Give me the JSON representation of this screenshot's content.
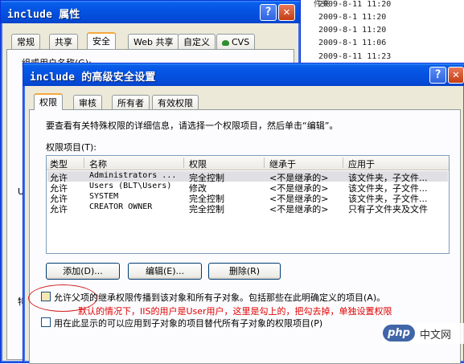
{
  "background_list": {
    "fragment_top": "件夹",
    "rows": [
      "2009-8-11 11:20",
      "2009-8-1 11:20",
      "2009-8-1 11:20",
      "2009-8-1 11:06",
      "2009-8-11 11:23"
    ]
  },
  "back_window": {
    "title": "include 属性",
    "help_btn": "?",
    "close_btn": "✕",
    "tabs": [
      "常规",
      "共享",
      "安全",
      "Web 共享",
      "自定义",
      "CVS"
    ],
    "active_tab": "安全",
    "group_label": "组或用户名称(G):",
    "side_letters": [
      "U",
      "特"
    ]
  },
  "front_window": {
    "title": "include 的高级安全设置",
    "help_btn": "?",
    "close_btn": "✕",
    "tabs": [
      "权限",
      "审核",
      "所有者",
      "有效权限"
    ],
    "active_tab": "权限",
    "instruction": "要查看有关特殊权限的详细信息，请选择一个权限项目，然后单击“编辑”。",
    "entries_label": "权限项目(T):",
    "columns": [
      "类型",
      "名称",
      "权限",
      "继承于",
      "应用于"
    ],
    "rows": [
      {
        "type": "允许",
        "name": "Administrators ...",
        "perm": "完全控制",
        "inherited": "<不是继承的>",
        "applies": "该文件夹，子文件..."
      },
      {
        "type": "允许",
        "name": "Users (BLT\\Users)",
        "perm": "修改",
        "inherited": "<不是继承的>",
        "applies": "该文件夹，子文件..."
      },
      {
        "type": "允许",
        "name": "SYSTEM",
        "perm": "完全控制",
        "inherited": "<不是继承的>",
        "applies": "该文件夹，子文件..."
      },
      {
        "type": "允许",
        "name": "CREATOR OWNER",
        "perm": "完全控制",
        "inherited": "<不是继承的>",
        "applies": "只有子文件夹及文件"
      }
    ],
    "buttons": {
      "add": "添加(D)...",
      "edit": "编辑(E)...",
      "remove": "删除(R)"
    },
    "checkbox1": "允许父项的继承权限传播到该对象和所有子对象。包括那些在此明确定义的项目(A)。",
    "checkbox2": "用在此显示的可以应用到子对象的项目替代所有子对象的权限项目(P)",
    "annotation": "默认的情况下，IIS的用户是User用户，这里是勾上的，把勾去掉，单独设置权限"
  },
  "watermark": {
    "logo": "php",
    "text": "中文网"
  },
  "colors": {
    "title_blue": "#0554e4",
    "annotation_red": "#e10000",
    "tab_highlight": "#f5a93d"
  }
}
